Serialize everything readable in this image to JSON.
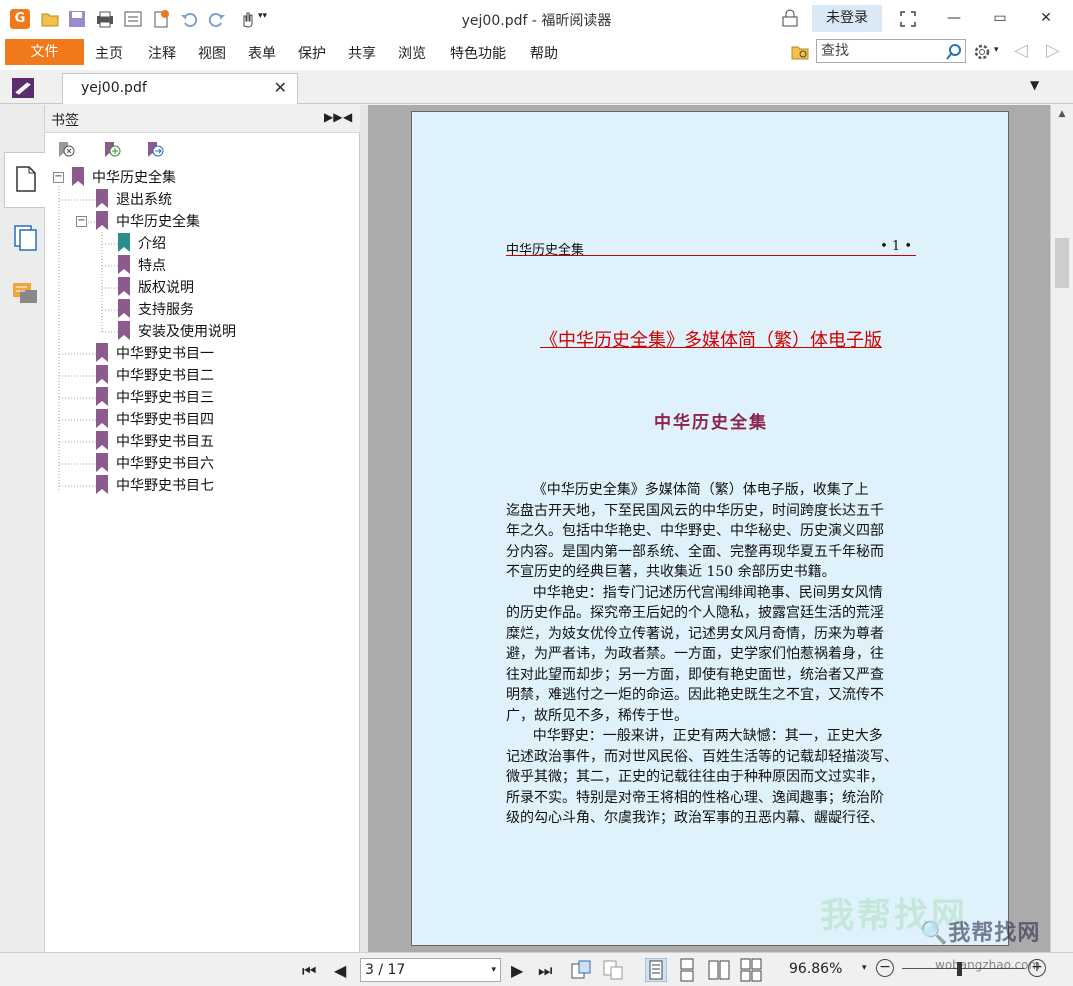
{
  "window": {
    "title": "yej00.pdf - 福昕阅读器",
    "login_label": "未登录"
  },
  "menu": {
    "file": "文件",
    "items": [
      "主页",
      "注释",
      "视图",
      "表单",
      "保护",
      "共享",
      "浏览",
      "特色功能",
      "帮助"
    ],
    "search_placeholder": "查找"
  },
  "tab": {
    "label": "yej00.pdf"
  },
  "bookmarks": {
    "title": "书签",
    "root": "中华历史全集",
    "items": [
      {
        "label": "退出系统",
        "level": 1
      },
      {
        "label": "中华历史全集",
        "level": 1
      },
      {
        "label": "介绍",
        "level": 2
      },
      {
        "label": "特点",
        "level": 2
      },
      {
        "label": "版权说明",
        "level": 2
      },
      {
        "label": "支持服务",
        "level": 2
      },
      {
        "label": "安装及使用说明",
        "level": 2
      },
      {
        "label": "中华野史书目一",
        "level": 1
      },
      {
        "label": "中华野史书目二",
        "level": 1
      },
      {
        "label": "中华野史书目三",
        "level": 1
      },
      {
        "label": "中华野史书目四",
        "level": 1
      },
      {
        "label": "中华野史书目五",
        "level": 1
      },
      {
        "label": "中华野史书目六",
        "level": 1
      },
      {
        "label": "中华野史书目七",
        "level": 1
      }
    ]
  },
  "page": {
    "header_title": "中华历史全集",
    "header_number": "• 1 •",
    "main_title": "《中华历史全集》多媒体简（繁）体电子版",
    "sub_title": "中华历史全集",
    "body_lines": [
      "      《中华历史全集》多媒体简（繁）体电子版，收集了上",
      "迄盘古开天地，下至民国风云的中华历史，时间跨度长达五千",
      "年之久。包括中华艳史、中华野史、中华秘史、历史演义四部",
      "分内容。是国内第一部系统、全面、完整再现华夏五千年秘而",
      "不宣历史的经典巨著，共收集近 150 余部历史书籍。",
      "      中华艳史：指专门记述历代宫闱绯闻艳事、民间男女风情",
      "的历史作品。探究帝王后妃的个人隐私，披露宫廷生活的荒淫",
      "糜烂，为妓女优伶立传著说，记述男女风月奇情，历来为尊者",
      "避，为严者讳，为政者禁。一方面，史学家们怕惹祸着身，往",
      "往对此望而却步；另一方面，即使有艳史面世，统治者又严查",
      "明禁，难逃付之一炬的命运。因此艳史既生之不宜，又流传不",
      "广，故所见不多，稀传于世。",
      "      中华野史：一般来讲，正史有两大缺憾：其一，正史大多",
      "记述政治事件，而对世风民俗、百姓生活等的记载却轻描淡写、",
      "微乎其微；其二，正史的记载往往由于种种原因而文过实非，",
      "所录不实。特别是对帝王将相的性格心理、逸闻趣事；统治阶",
      "级的勾心斗角、尔虞我诈；政治军事的丑恶内幕、龌龊行径、"
    ]
  },
  "status": {
    "page_indicator": "3 / 17",
    "zoom": "96.86%"
  },
  "watermark": {
    "cn": "我帮找网",
    "url": "wobangzhao.com"
  },
  "colors": {
    "accent": "#f07a1b",
    "bookmark_flag": "#8c5a8c",
    "bookmark_flag_selected": "#2a8c8c",
    "page_bg": "#dff2fb",
    "title_red": "#d00000"
  }
}
